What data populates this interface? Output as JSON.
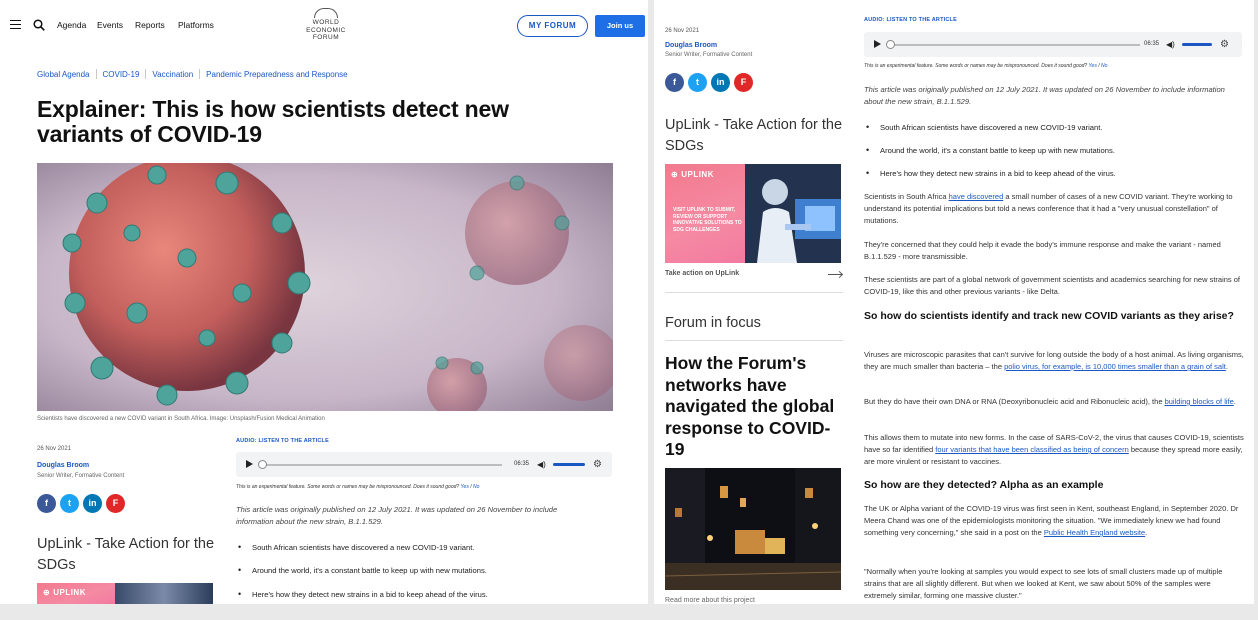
{
  "header": {
    "nav": [
      "Agenda",
      "Events",
      "Reports",
      "Platforms"
    ],
    "logo_lines": [
      "WORLD",
      "ECONOMIC",
      "FORUM"
    ],
    "my_forum": "MY FORUM",
    "join": "Join us"
  },
  "article": {
    "tags": [
      "Global Agenda",
      "COVID-19",
      "Vaccination",
      "Pandemic Preparedness and Response"
    ],
    "title": "Explainer: This is how scientists detect new variants of COVID-19",
    "caption": "Scientists have discovered a new COVID variant in South Africa.    Image: Unsplash/Fusion Medical Animation",
    "date": "26 Nov 2021",
    "author": "Douglas Broom",
    "author_role": "Senior Writer, Formative Content",
    "share": [
      "f",
      "t",
      "in",
      "F"
    ],
    "audio_label": "AUDIO: LISTEN TO THE ARTICLE",
    "audio_time": "06:35",
    "experimental": "This is an experimental feature. Some words or names may be mispronounced. Does it sound good?",
    "exp_yes": "Yes",
    "exp_sep": " / ",
    "exp_no": "No",
    "original_note": "This article was originally published on 12 July 2021. It was updated on 26 November to include information about the new strain, B.1.1.529.",
    "bullets": [
      "South African scientists have discovered a new COVID-19 variant.",
      "Around the world, it's a constant battle to keep up with new mutations.",
      "Here's how they detect new strains in a bid to keep ahead of the virus."
    ],
    "p1_a": "Scientists in South Africa ",
    "p1_link": "have discovered",
    "p1_b": " a small number of cases of a new COVID variant. They're working to understand its potential implications but told a news conference that it had a \"very unusual constellation\" of mutations.",
    "p2": "They're concerned that they could help it evade the body's immune response and make the variant - named B.1.1.529 - more transmissible.",
    "p3": "These scientists are part of a global network of government scientists and academics searching for new strains of COVID-19, like this and other previous variants - like Delta.",
    "h2": "So how do scientists identify and track new COVID variants as they arise?",
    "p4_a": "Viruses are microscopic parasites that can't survive for long outside the body of a host animal. As living organisms, they are much smaller than bacteria – the ",
    "p4_link": "polio virus, for example, is 10,000 times smaller than a grain of salt",
    "p4_b": ".",
    "p5_a": "But they do have their own DNA or RNA (Deoxyribonucleic acid and Ribonucleic acid), the ",
    "p5_link": "building blocks of life",
    "p5_b": ".",
    "p6_a": "This allows them to mutate into new forms. In the case of SARS-CoV-2, the virus that causes COVID-19, scientists have so far identified ",
    "p6_link": "four variants that have been classified as being of concern",
    "p6_b": " because they spread more easily, are more virulent or resistant to vaccines.",
    "h3": "So how are they detected? Alpha as an example",
    "p7_a": "The UK or Alpha variant of the COVID-19 virus was first seen in Kent, southeast England, in September 2020. Dr Meera Chand was one of the epidemiologists monitoring the situation. \"We immediately knew we had found something very concerning,\" she said in a post on the ",
    "p7_link": "Public Health England website",
    "p7_b": ".",
    "p8": "\"Normally when you're looking at samples you would expect to see lots of small clusters made up of multiple strains that are all slightly different. But when we looked at Kent, we saw about 50% of the samples were extremely similar, forming one massive cluster.\""
  },
  "sidebar": {
    "uplink_heading": "UpLink - Take Action for the SDGs",
    "uplink_logo": "UPLINK",
    "uplink_copy": "VISIT UPLINK TO SUBMIT, REVIEW OR SUPPORT INNOVATIVE SOLUTIONS TO SDG CHALLENGES",
    "uplink_cta": "Take action on UpLink",
    "focus_heading": "Forum in focus",
    "focus_title": "How the Forum's networks have navigated the global response to COVID-19",
    "read_more": "Read more about this project"
  },
  "colors": {
    "brand_blue": "#1a57c5",
    "join_blue": "#1e6ee6",
    "uplink_pink": "#f27a8d"
  }
}
